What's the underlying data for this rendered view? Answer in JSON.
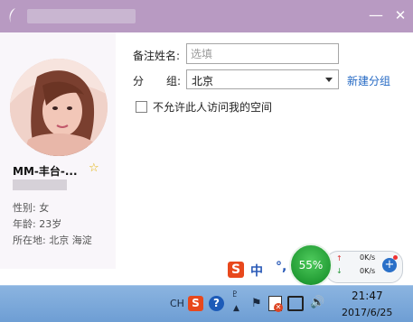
{
  "window": {
    "title": "",
    "minimize_glyph": "—",
    "close_glyph": "✕",
    "icons": {
      "app": "app-icon",
      "minimize": "minimize-icon",
      "close": "close-icon"
    }
  },
  "profile": {
    "nickname": "MM-丰台-...",
    "star_glyph": "☆",
    "account": "",
    "gender": "性别: 女",
    "age": "年龄: 23岁",
    "location": "所在地: 北京  海淀"
  },
  "form": {
    "remark_label": "备注姓名:",
    "remark_placeholder": "选填",
    "remark_value": "",
    "group_label_a": "分",
    "group_label_b": "组:",
    "group_value": "北京",
    "new_group_link": "新建分组",
    "checkbox_label": "不允许此人访问我的空间",
    "checkbox_checked": false
  },
  "ime": {
    "logo": "S",
    "mode": "中",
    "punct": "°,"
  },
  "speed_widget": {
    "percent": "55%",
    "up_arrow": "↑",
    "down_arrow": "↓",
    "upload": "0K/s",
    "download": "0K/s",
    "plus": "+"
  },
  "taskbar": {
    "lang": "CH",
    "sogou": "S",
    "help": "?",
    "a_glyph": "♇",
    "up_glyph": "▲",
    "flag_glyph": "⚑",
    "action_x": "✕",
    "volume_glyph": "🔊",
    "time": "21:47",
    "date": "2017/6/25"
  },
  "colors": {
    "titlebar": "#b89ac2",
    "link": "#2469c4",
    "star": "#e2b100",
    "speed_ball": "#229c34",
    "taskbar": "#7aa8db"
  }
}
